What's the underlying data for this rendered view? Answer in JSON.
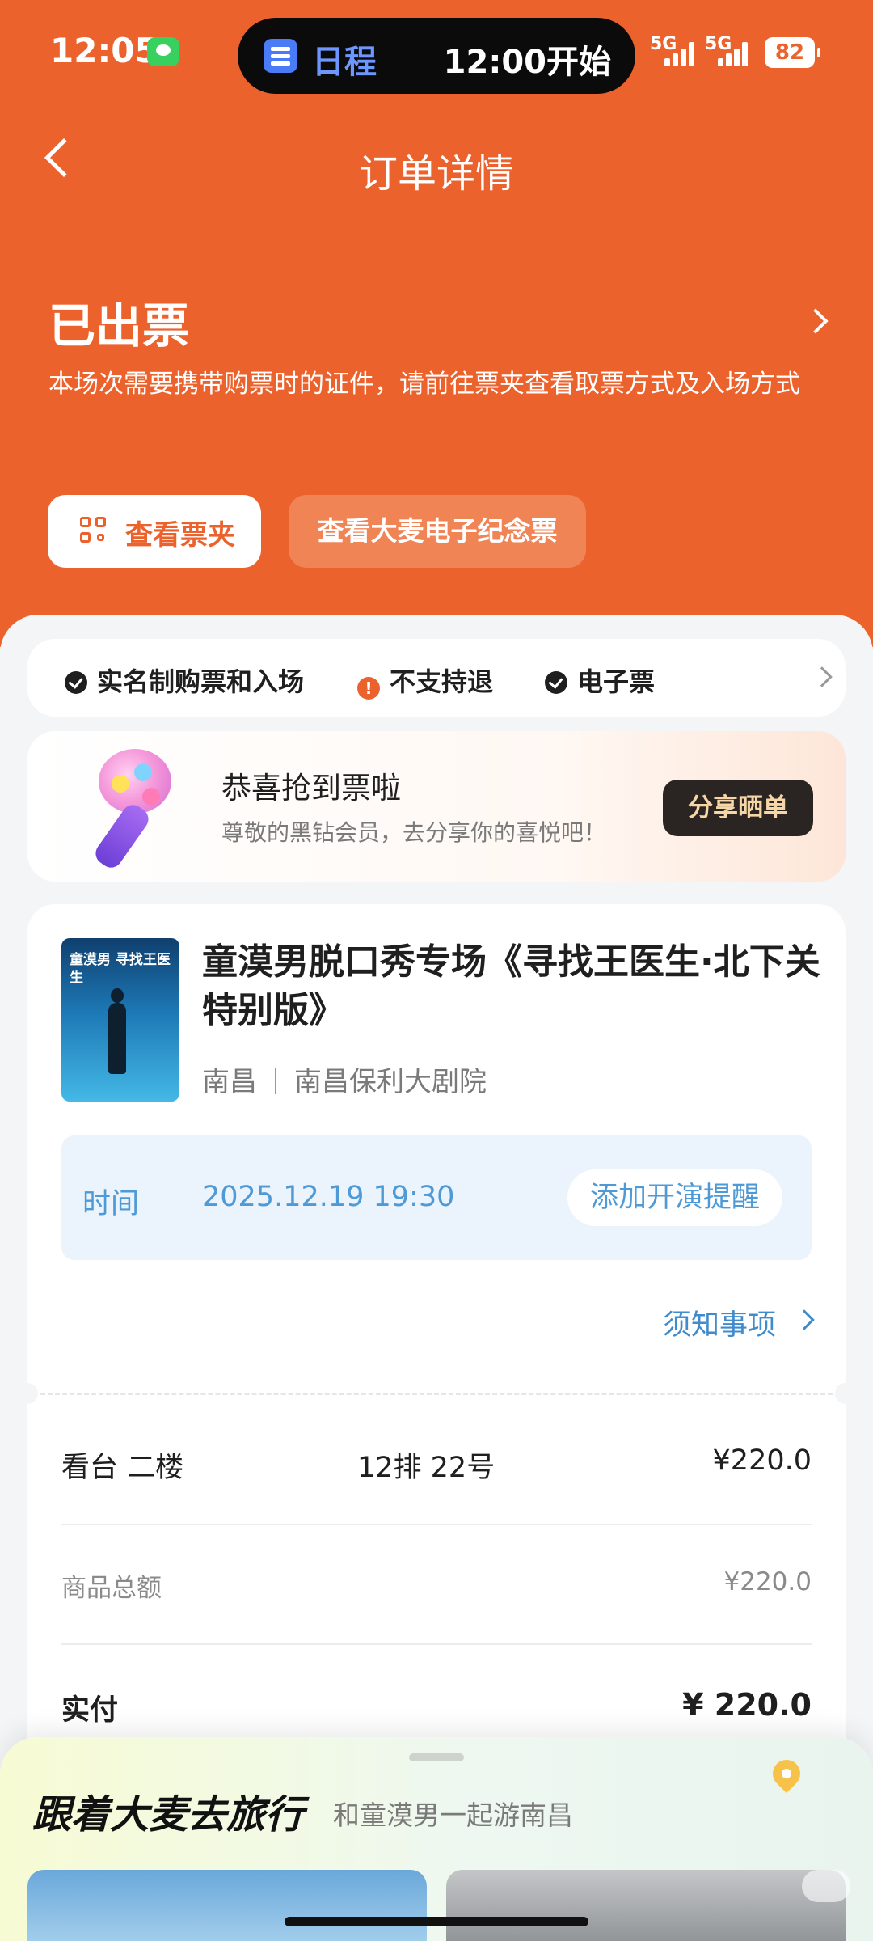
{
  "status_bar": {
    "time": "12:05",
    "island_title": "日程",
    "island_time": "12:00开始",
    "network1": "5G",
    "network2": "5G",
    "battery": "82"
  },
  "nav": {
    "title": "订单详情"
  },
  "order_status": {
    "title": "已出票",
    "description": "本场次需要携带购票时的证件，请前往票夹查看取票方式及入场方式"
  },
  "actions": {
    "wallet_label": "查看票夹",
    "souvenir_label": "查看大麦电子纪念票"
  },
  "features": [
    {
      "label": "实名制购票和入场",
      "icon": "check-circle-icon"
    },
    {
      "label": "不支持退",
      "icon": "warning-circle-icon"
    },
    {
      "label": "电子票",
      "icon": "check-circle-icon"
    }
  ],
  "promo": {
    "title": "恭喜抢到票啦",
    "subtitle": "尊敬的黑钻会员，去分享你的喜悦吧！",
    "button": "分享晒单"
  },
  "show": {
    "poster_text": "童漠男 寻找王医生",
    "title": "童漠男脱口秀专场《寻找王医生·北下关特别版》",
    "city": "南昌",
    "venue": "南昌保利大剧院",
    "time_label": "时间",
    "time_value": "2025.12.19 19:30",
    "remind_button": "添加开演提醒",
    "notice_link": "须知事项"
  },
  "ticket": {
    "area": "看台 二楼",
    "seat": "12排 22号",
    "price": "¥220.0"
  },
  "summary": {
    "subtotal_label": "商品总额",
    "subtotal_value": "¥220.0",
    "paid_label": "实付",
    "paid_value": "¥ 220.0"
  },
  "travel": {
    "title": "跟着大麦去旅行",
    "subtitle": "和童漠男一起游南昌"
  },
  "colors": {
    "brand_orange": "#ec622d",
    "link_blue": "#3f8bcc",
    "share_gold": "#f7d6a6"
  }
}
